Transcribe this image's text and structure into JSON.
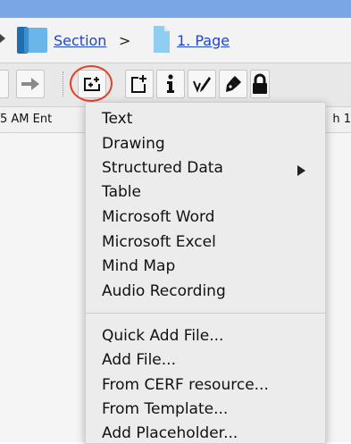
{
  "breadcrumb": {
    "section_label": "Section",
    "separator": ">",
    "page_label": "1. Page"
  },
  "toolbar": {
    "buttons": [
      {
        "name": "forward-button",
        "icon": "arrow-right-icon"
      },
      {
        "name": "add-content-button",
        "icon": "add-content-icon"
      },
      {
        "name": "add-page-button",
        "icon": "add-page-icon"
      },
      {
        "name": "info-button",
        "icon": "info-icon"
      },
      {
        "name": "signature-button",
        "icon": "signature-pen-icon"
      },
      {
        "name": "pen-button",
        "icon": "fountain-pen-icon"
      },
      {
        "name": "lock-button",
        "icon": "lock-icon"
      }
    ]
  },
  "list": {
    "row_left_text": "5 AM Ent",
    "row_right_text": "h 1"
  },
  "menu": {
    "group1": [
      "Text",
      "Drawing",
      "Structured Data",
      "Table",
      "Microsoft Word",
      "Microsoft Excel",
      "Mind Map",
      "Audio Recording"
    ],
    "group2": [
      "Quick Add File...",
      "Add File...",
      "From CERF resource...",
      "From Template...",
      "Add Placeholder..."
    ]
  },
  "colors": {
    "title_bar": "#7aa6e6",
    "link": "#1f46c8",
    "highlight_ring": "#e2412a",
    "menu_bg": "#ececec"
  }
}
